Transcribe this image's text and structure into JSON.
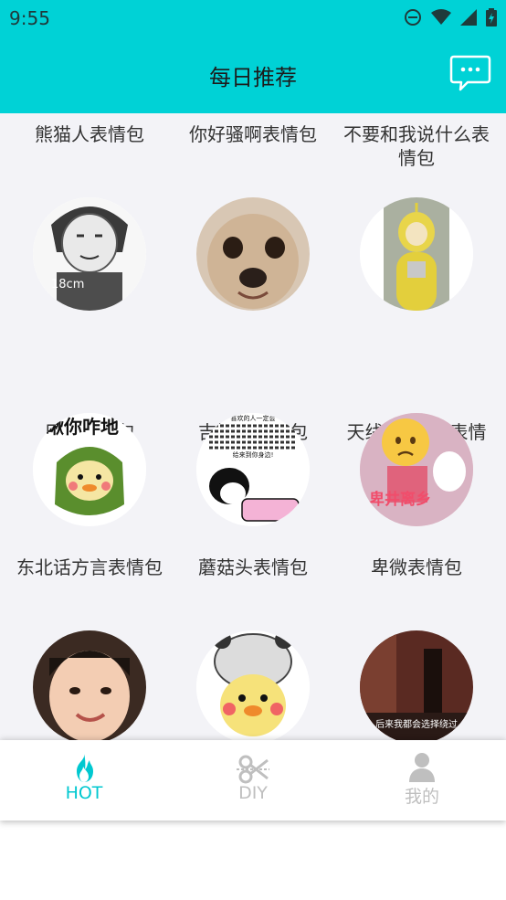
{
  "status_bar": {
    "time": "9:55"
  },
  "header": {
    "title": "每日推荐",
    "message_icon": "chat-bubble-icon"
  },
  "colors": {
    "accent": "#00d2d6",
    "nav_active": "#00c8d0",
    "nav_inactive": "#bfbfbf",
    "content_bg": "#f3f3f7"
  },
  "grid": {
    "row0": [
      "熊猫人表情包",
      "你好骚啊表情包",
      "不要和我说什么表情包"
    ],
    "row1": [
      "日常表情包",
      "吉娃娃表情包",
      "天线宝宝GIF表情包"
    ],
    "row2": [
      "东北话方言表情包",
      "蘑菇头表情包",
      "卑微表情包"
    ]
  },
  "thumb_text": {
    "panda_18cm": "18cm",
    "dongbei": "瞅你咋地",
    "mogu_top": "喜欢的人一定会",
    "mogu_bottom": "给来到你身边!",
    "beiwei": "卑井离乡",
    "street": "后来我都会选择绕过"
  },
  "bottom_nav": {
    "items": [
      {
        "label": "HOT",
        "icon": "flame-icon",
        "active": true
      },
      {
        "label": "DIY",
        "icon": "scissors-icon",
        "active": false
      },
      {
        "label": "我的",
        "icon": "user-icon",
        "active": false
      }
    ]
  }
}
